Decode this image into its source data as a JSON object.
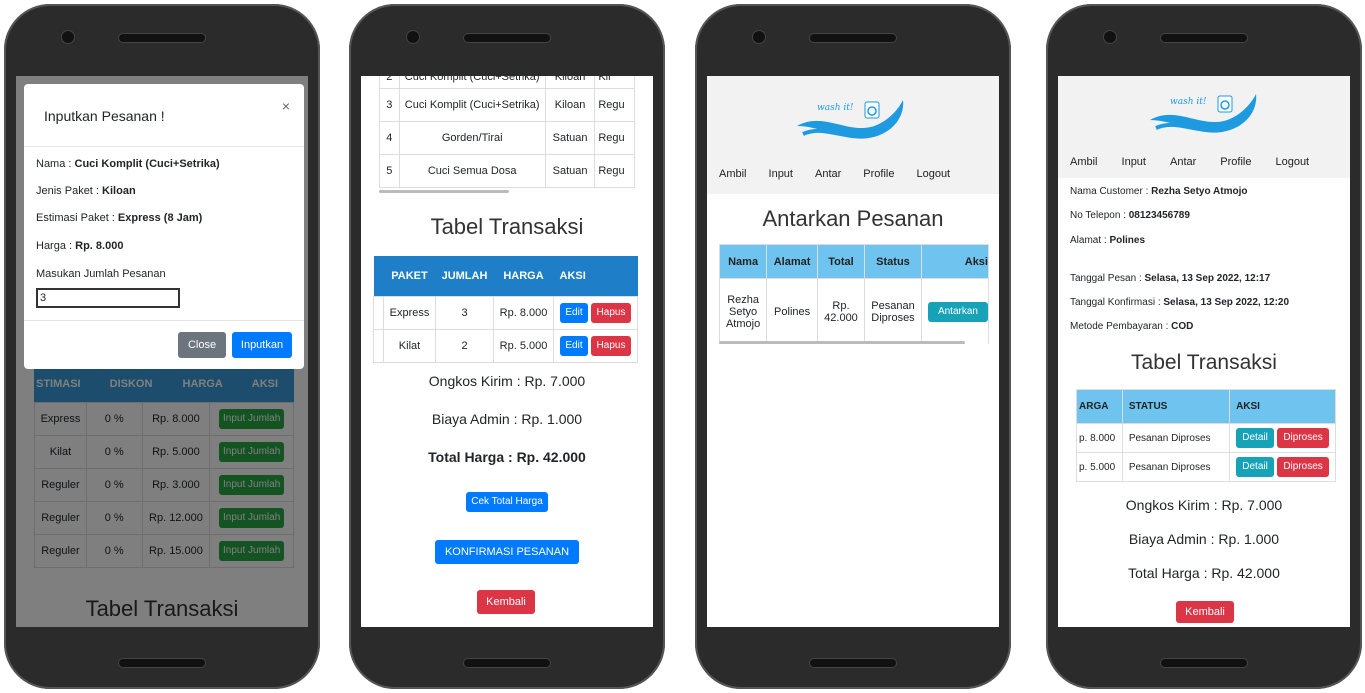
{
  "p1": {
    "modal": {
      "title": "Inputkan Pesanan !",
      "close_x": "×",
      "nama_label": "Nama : ",
      "nama": "Cuci Komplit (Cuci+Setrika)",
      "jenis_label": "Jenis Paket : ",
      "jenis": "Kiloan",
      "estimasi_label": "Estimasi Paket : ",
      "estimasi": "Express (8 Jam)",
      "harga_label": "Harga : ",
      "harga": "Rp. 8.000",
      "jumlah_label": "Masukan Jumlah Pesanan",
      "jumlah_value": "3",
      "close_btn": "Close",
      "input_btn": "Inputkan"
    },
    "table": {
      "headers": [
        "STIMASI",
        "DISKON",
        "HARGA",
        "AKSI"
      ],
      "rows": [
        [
          "Express",
          "0 %",
          "Rp. 8.000",
          "Input Jumlah"
        ],
        [
          "Kilat",
          "0 %",
          "Rp. 5.000",
          "Input Jumlah"
        ],
        [
          "Reguler",
          "0 %",
          "Rp. 3.000",
          "Input Jumlah"
        ],
        [
          "Reguler",
          "0 %",
          "Rp. 12.000",
          "Input Jumlah"
        ],
        [
          "Reguler",
          "0 %",
          "Rp. 15.000",
          "Input Jumlah"
        ]
      ]
    },
    "section_title": "Tabel Transaksi"
  },
  "p2": {
    "paket_rows": [
      [
        "2",
        "Cuci Komplit (Cuci+Setrika)",
        "Kiloan",
        "Kil"
      ],
      [
        "3",
        "Cuci Komplit (Cuci+Setrika)",
        "Kiloan",
        "Regu"
      ],
      [
        "4",
        "Gorden/Tirai",
        "Satuan",
        "Regu"
      ],
      [
        "5",
        "Cuci Semua Dosa",
        "Satuan",
        "Regu"
      ]
    ],
    "title": "Tabel Transaksi",
    "trans_headers": [
      "PAKET",
      "JUMLAH",
      "HARGA",
      "AKSI"
    ],
    "trans_rows": [
      [
        "Express",
        "3",
        "Rp. 8.000"
      ],
      [
        "Kilat",
        "2",
        "Rp. 5.000"
      ]
    ],
    "edit": "Edit",
    "hapus": "Hapus",
    "ongkos": "Ongkos Kirim : Rp. 7.000",
    "admin": "Biaya Admin : Rp. 1.000",
    "total": "Total Harga : Rp. 42.000",
    "cek_btn": "Cek Total Harga",
    "konfirmasi_btn": "KONFIRMASI PESANAN",
    "kembali_btn": "Kembali"
  },
  "p3": {
    "logo": "wash it!",
    "nav": [
      "Ambil",
      "Input",
      "Antar",
      "Profile",
      "Logout"
    ],
    "title": "Antarkan Pesanan",
    "headers": [
      "Nama",
      "Alamat",
      "Total",
      "Status",
      "Aksi"
    ],
    "row": {
      "nama": "Rezha Setyo Atmojo",
      "alamat": "Polines",
      "total": "Rp. 42.000",
      "status": "Pesanan Diproses",
      "aksi": "Antarkan"
    }
  },
  "p4": {
    "logo": "wash it!",
    "nav": [
      "Ambil",
      "Input",
      "Antar",
      "Profile",
      "Logout"
    ],
    "nama_label": "Nama Customer : ",
    "nama": "Rezha Setyo Atmojo",
    "telp_label": "No Telepon : ",
    "telp": "08123456789",
    "alamat_label": "Alamat : ",
    "alamat": "Polines",
    "tgl_pesan_label": "Tanggal Pesan : ",
    "tgl_pesan": "Selasa, 13 Sep 2022, 12:17",
    "tgl_konf_label": "Tanggal Konfirmasi : ",
    "tgl_konf": "Selasa, 13 Sep 2022, 12:20",
    "metode_label": "Metode Pembayaran : ",
    "metode": "COD",
    "title": "Tabel Transaksi",
    "headers": [
      "ARGA",
      "STATUS",
      "AKSI"
    ],
    "rows": [
      [
        "p. 8.000",
        "Pesanan Diproses"
      ],
      [
        "p. 5.000",
        "Pesanan Diproses"
      ]
    ],
    "detail": "Detail",
    "diproses": "Diproses",
    "ongkos": "Ongkos Kirim : Rp. 7.000",
    "admin": "Biaya Admin : Rp. 1.000",
    "total": "Total Harga : Rp. 42.000",
    "kembali_btn": "Kembali"
  }
}
